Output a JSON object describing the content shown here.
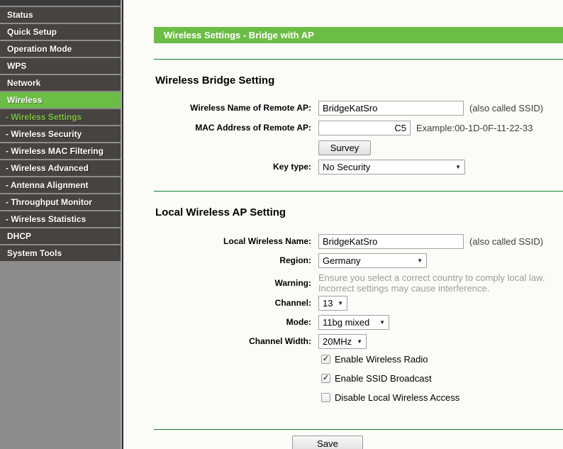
{
  "header": {
    "title": "Wireless Settings - Bridge with AP"
  },
  "sidebar": {
    "items": [
      {
        "label": "Status",
        "active": false
      },
      {
        "label": "Quick Setup",
        "active": false
      },
      {
        "label": "Operation Mode",
        "active": false
      },
      {
        "label": "WPS",
        "active": false
      },
      {
        "label": "Network",
        "active": false
      },
      {
        "label": "Wireless",
        "active": true
      },
      {
        "label": "- Wireless Settings",
        "active": true
      },
      {
        "label": "- Wireless Security",
        "active": false
      },
      {
        "label": "- Wireless MAC Filtering",
        "active": false
      },
      {
        "label": "- Wireless Advanced",
        "active": false
      },
      {
        "label": "- Antenna Alignment",
        "active": false
      },
      {
        "label": "- Throughput Monitor",
        "active": false
      },
      {
        "label": "- Wireless Statistics",
        "active": false
      },
      {
        "label": "DHCP",
        "active": false
      },
      {
        "label": "System Tools",
        "active": false
      }
    ]
  },
  "bridge": {
    "heading": "Wireless Bridge Setting",
    "remote_name_label": "Wireless Name of Remote AP:",
    "remote_name_value": "BridgeKatSro",
    "remote_name_note": "(also called SSID)",
    "remote_mac_label": "MAC Address of Remote AP:",
    "remote_mac_value": "C5",
    "remote_mac_note": "Example:00-1D-0F-11-22-33",
    "survey_label": "Survey",
    "key_type_label": "Key type:",
    "key_type_value": "No Security"
  },
  "ap": {
    "heading": "Local Wireless AP Setting",
    "local_name_label": "Local Wireless Name:",
    "local_name_value": "BridgeKatSro",
    "local_name_note": "(also called SSID)",
    "region_label": "Region:",
    "region_value": "Germany",
    "warning_label": "Warning:",
    "warning_line1": "Ensure you select a correct country to comply local law.",
    "warning_line2": "Incorrect settings may cause interference.",
    "channel_label": "Channel:",
    "channel_value": "13",
    "mode_label": "Mode:",
    "mode_value": "11bg mixed",
    "channel_width_label": "Channel Width:",
    "channel_width_value": "20MHz",
    "checkboxes": [
      {
        "label": "Enable Wireless Radio",
        "checked": true
      },
      {
        "label": "Enable SSID Broadcast",
        "checked": true
      },
      {
        "label": "Disable Local Wireless Access",
        "checked": false
      }
    ]
  },
  "footer": {
    "save_label": "Save"
  },
  "colors": {
    "accent_green": "#6cbd45",
    "separator_green": "#17792f",
    "sidebar_item_bg": "#474341",
    "sidebar_bg": "#8c8c8c",
    "active_sub_text": "#7fc241"
  }
}
